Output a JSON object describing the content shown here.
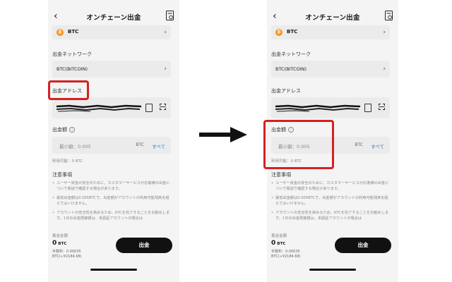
{
  "left": {
    "header_title": "オンチェーン出金",
    "coin": "BTC",
    "network_label": "出金ネットワーク",
    "network_value": "BTC(BITCOIN)",
    "address_label": "出金アドレス",
    "amount_label": "出金額",
    "amount_placeholder": "最小額：0.005",
    "amount_unit": "BTC",
    "amount_all": "すべて",
    "available": "利用可能：0 BTC",
    "notes_title": "注意事項",
    "notes": [
      "ユーザー資金の安全のために、カスタマーサービスがお客様の出金について電話で確認する場合があります。",
      "最低出金額は0.005BTCで、出金額がアカウントの利用可能残高を超えてはいけません。",
      "アカウントの安全性を高めるため、KYCを完了することをお勧めします。1日の出金限度額は、未認証アカウントの場合は"
    ],
    "fee_label": "着金金額",
    "fee_amount": "0",
    "fee_unit": "BTC",
    "fee_line1": "手数料：0.00035",
    "fee_line2": "BTC(≈¥2184.68)",
    "submit": "出金"
  },
  "right": {
    "header_title": "オンチェーン出金",
    "coin": "BTC",
    "network_label": "出金ネットワーク",
    "network_value": "BTC(BITCOIN)",
    "address_label": "出金アドレス",
    "amount_label": "出金額",
    "amount_placeholder": "最小額：0.005",
    "amount_unit": "BTC",
    "amount_all": "すべて",
    "available": "利用可能：0 BTC",
    "notes_title": "注意事項",
    "notes": [
      "ユーザー資金の安全のために、カスタマーサービスがお客様の出金について電話で確認する場合があります。",
      "最低出金額は0.005BTCで、出金額がアカウントの利用可能残高を超えてはいけません。",
      "アカウントの安全性を高めるため、KYCを完了することをお勧めします。1日の出金限度額は、未認証アカウントの場合は"
    ],
    "fee_label": "着金金額",
    "fee_amount": "0",
    "fee_unit": "BTC",
    "fee_line1": "手数料：0.00035",
    "fee_line2": "BTC(≈¥2184.68)",
    "submit": "出金"
  },
  "colors": {
    "highlight": "#d62020",
    "accent_link": "#2a7fd0",
    "button": "#111111"
  },
  "icons": [
    "back-arrow-icon",
    "history-icon",
    "bitcoin-icon",
    "chevron-right-icon",
    "paste-icon",
    "scan-icon",
    "info-icon",
    "right-arrow-icon"
  ]
}
